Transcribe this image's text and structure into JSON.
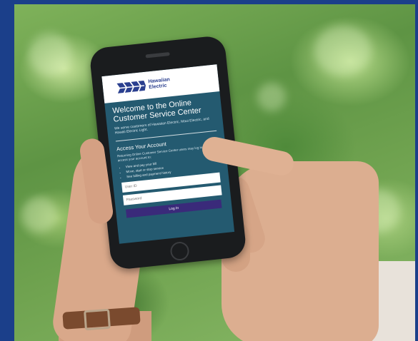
{
  "brand": {
    "name_line1": "Hawaiian",
    "name_line2": "Electric",
    "logo_color": "#2a3f8f"
  },
  "hero": {
    "title": "Welcome to the Online Customer Service Center",
    "subtitle": "We serve customers of Hawaiian Electric, Maui Electric, and Hawaii Electric Light."
  },
  "account": {
    "heading": "Access Your Account",
    "intro": "Returning Online Customer Service Center users may log in and access your account to:",
    "bullets": [
      "View and pay your bill",
      "Move, start or stop service",
      "See billing and payment history"
    ],
    "user_placeholder": "User ID",
    "password_placeholder": "Password",
    "login_label": "Log In"
  },
  "colors": {
    "frame": "#1b3f8a",
    "screen_bg": "#245a70",
    "login_button": "#3a2a7a"
  }
}
